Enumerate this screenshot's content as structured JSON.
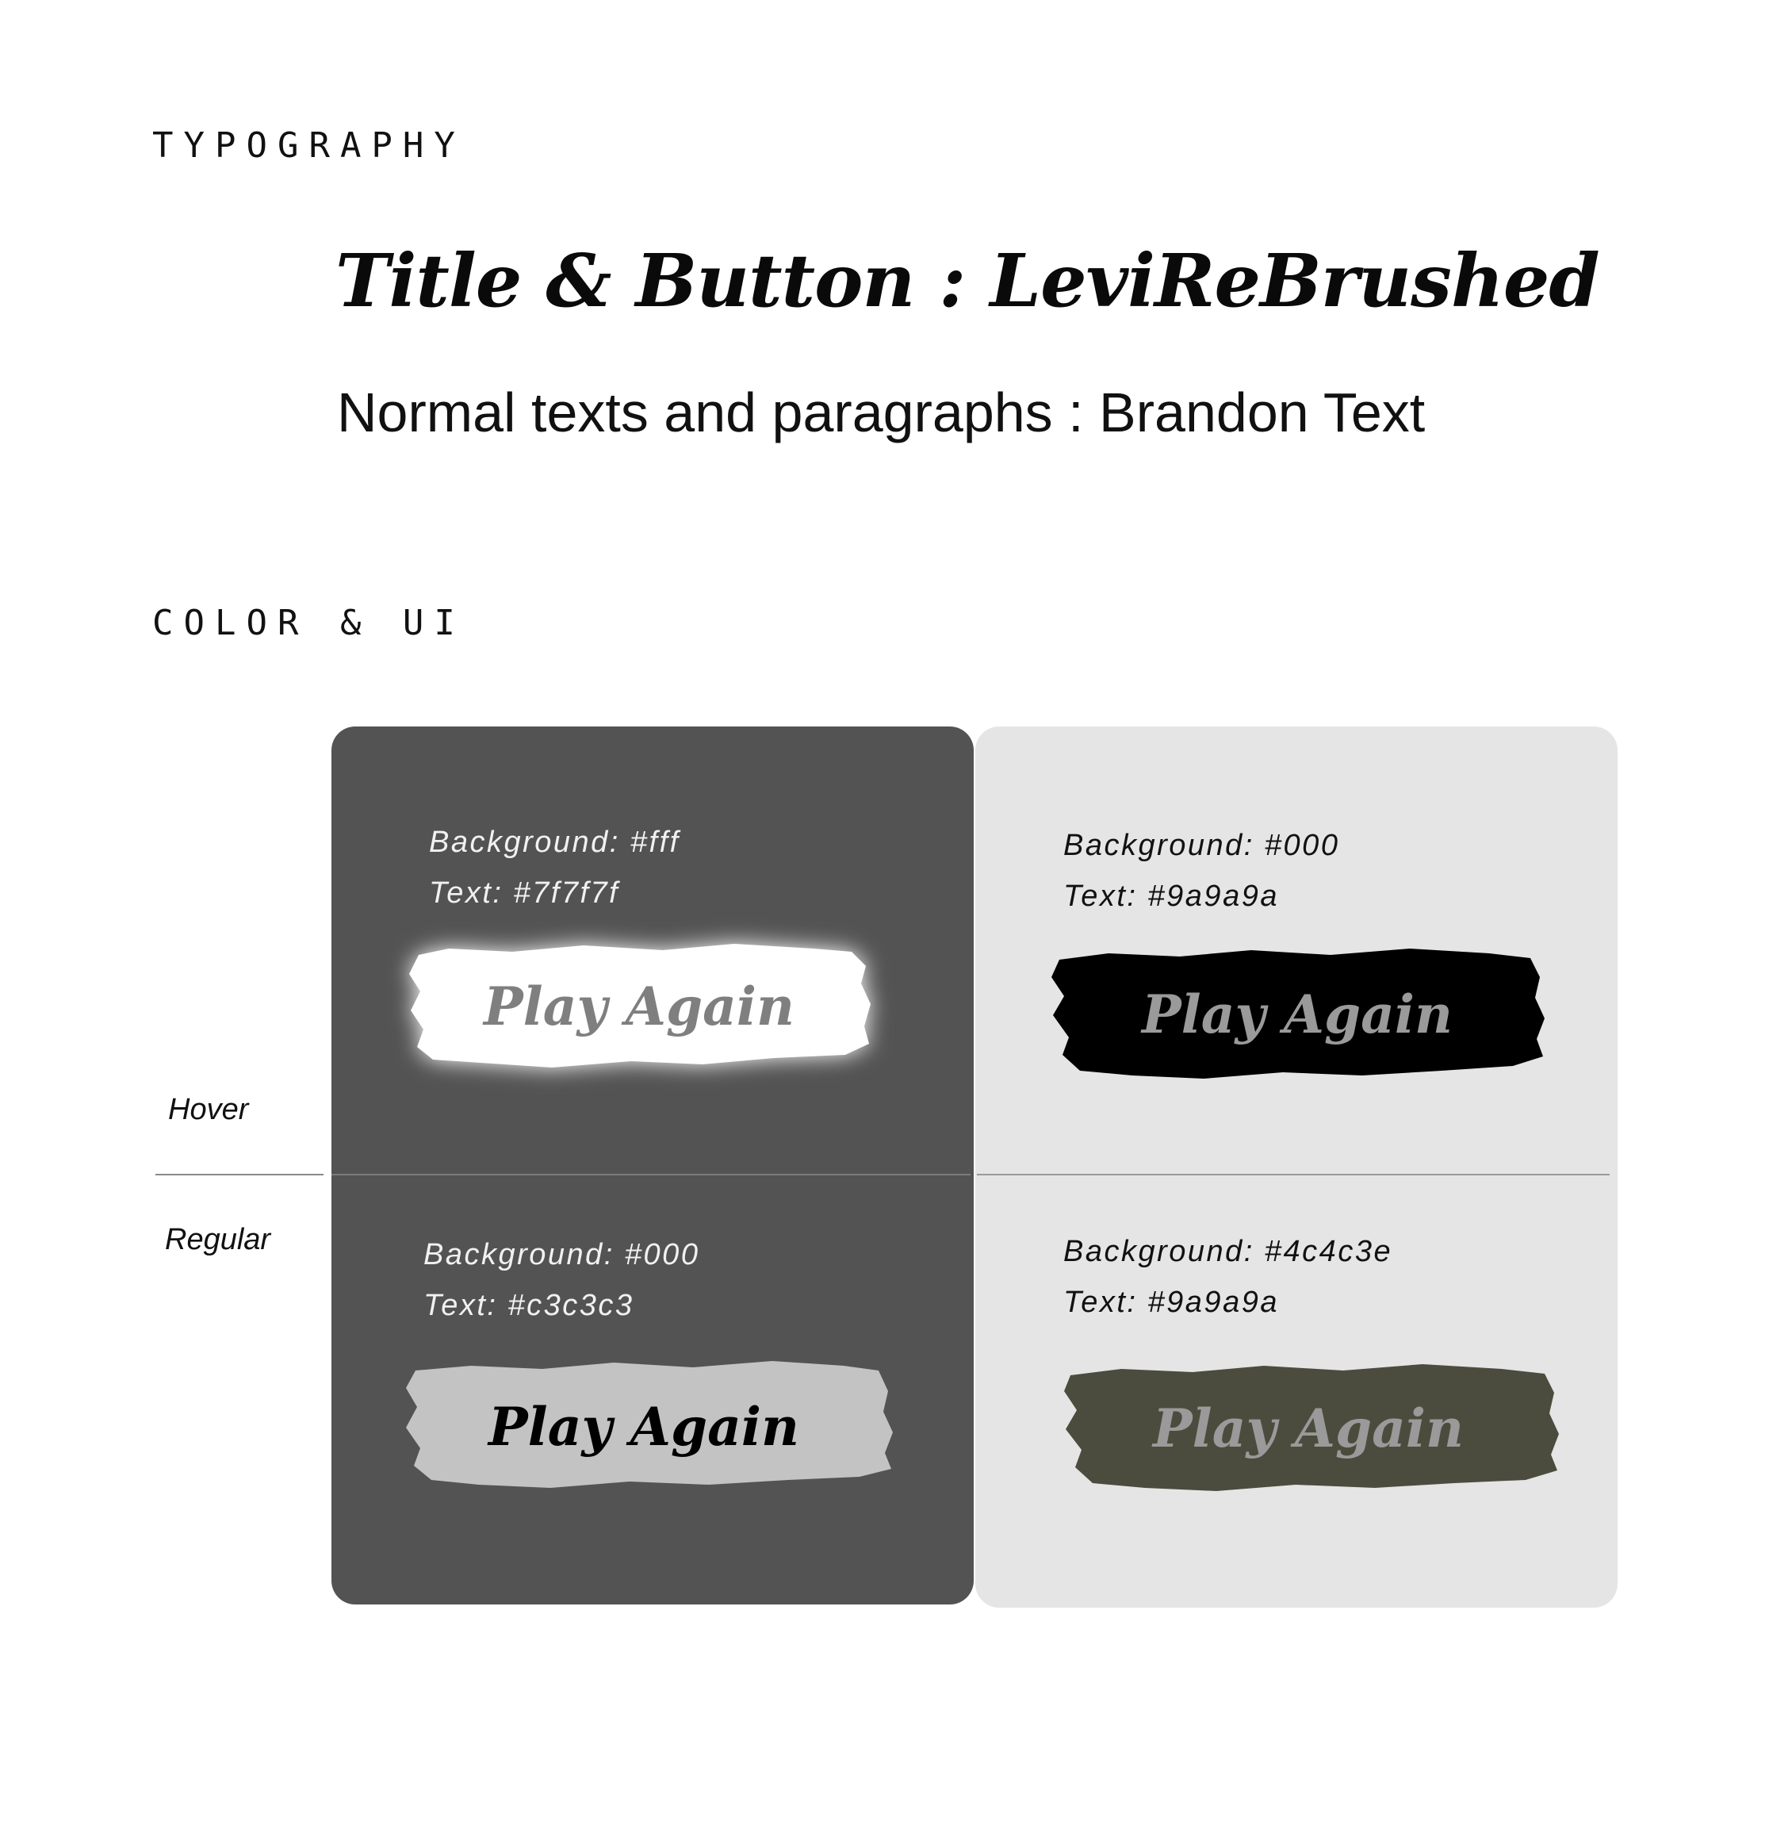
{
  "typography": {
    "heading": "TYPOGRAPHY",
    "title_font_line": "Title & Button : LeviReBrushed",
    "body_font_line": "Normal texts and paragraphs : Brandon Text"
  },
  "color_ui": {
    "heading": "COLOR & UI",
    "row_labels": {
      "hover": "Hover",
      "regular": "Regular"
    },
    "panels": {
      "dark_panel_color": "#535353",
      "light_panel_color": "#e5e5e5"
    },
    "variants": [
      {
        "state": "hover",
        "panel": "dark",
        "background_label": "Background: #fff",
        "text_label": "Text: #7f7f7f",
        "button_label": "Play Again",
        "button_background": "#ffffff",
        "button_text_color": "#7f7f7f"
      },
      {
        "state": "hover",
        "panel": "light",
        "background_label": "Background: #000",
        "text_label": "Text: #9a9a9a",
        "button_label": "Play Again",
        "button_background": "#000000",
        "button_text_color": "#9a9a9a"
      },
      {
        "state": "regular",
        "panel": "dark",
        "background_label": "Background: #000",
        "text_label": "Text: #c3c3c3",
        "button_label": "Play Again",
        "button_background": "#c3c3c3",
        "button_text_color": "#000000"
      },
      {
        "state": "regular",
        "panel": "light",
        "background_label": "Background: #4c4c3e",
        "text_label": "Text: #9a9a9a",
        "button_label": "Play Again",
        "button_background": "#4c4c3e",
        "button_text_color": "#9a9a9a"
      }
    ]
  }
}
